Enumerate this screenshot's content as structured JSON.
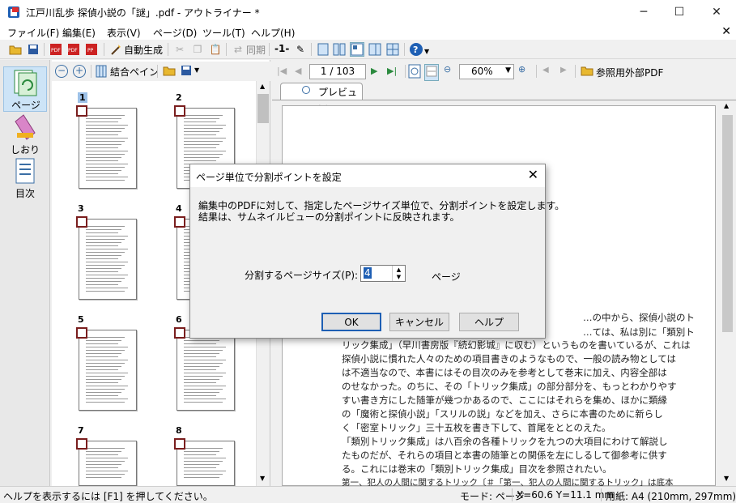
{
  "window": {
    "title": "江戸川乱歩 探偵小説の「謎」.pdf - アウトライナー *"
  },
  "menu": [
    "ファイル(F)",
    "編集(E)",
    "表示(V)",
    "ページ(D)",
    "ツール(T)",
    "ヘルプ(H)"
  ],
  "toolbar": {
    "auto_generate": "自動生成",
    "sync": "同期",
    "page_marker": "-1-",
    "help": "?"
  },
  "nav": {
    "pages": "ページ",
    "bookmarks": "しおり",
    "toc": "目次"
  },
  "thumb_toolbar": {
    "join_panes": "結合ペイン"
  },
  "thumbnails": [
    "1",
    "2",
    "3",
    "4",
    "5",
    "6",
    "7",
    "8"
  ],
  "viewer": {
    "page_field": "1 / 103",
    "zoom": "60%",
    "external_pdf": "参照用外部PDF",
    "tab": "プレビュー"
  },
  "pdf_lines": [
    "…の中から、探偵小説のト",
    "…ては、私は別に「類別ト",
    "リック集成」（早川書房版『続幻影城』に収む）というものを書いているが、これは",
    "探偵小説に慣れた人々のための項目書きのようなもので、一般の読み物としては",
    "は不適当なので、本書にはその目次のみを参考として巻末に加え、内容全部は",
    "のせなかった。のちに、その「トリック集成」の部分部分を、もっとわかりやす",
    "すい書き方にした随筆が幾つかあるので、ここにはそれらを集め、ほかに類縁",
    "の「魔術と探偵小説」「スリルの説」などを加え、さらに本書のために新らし",
    "く「密室トリック」三十五枚を書き下して、首尾をととのえた。",
    "「類別トリック集成」は八百余の各種トリックを九つの大項目にわけて解説し",
    "たものだが、それらの項目と本書の随筆との関係を左にしるして御参考に供す",
    "る。これには巻末の「類別トリック集成」目次を参照されたい。",
    "第一、犯人の人間に関するトリック〔＃「第一、犯人の人間に関するトリック」は底本"
  ],
  "dialog": {
    "title": "ページ単位で分割ポイントを設定",
    "line1": "編集中のPDFに対して、指定したページサイズ単位で、分割ポイントを設定します。",
    "line2": "結果は、サムネイルビューの分割ポイントに反映されます。",
    "field_label": "分割するページサイズ(P):",
    "field_value": "4",
    "unit": "ページ",
    "ok": "OK",
    "cancel": "キャンセル",
    "help": "ヘルプ"
  },
  "status": {
    "help": "ヘルプを表示するには [F1] を押してください。",
    "mode": "モード: ページ",
    "coords": "X=60.6 Y=11.1 mm",
    "paper": "用紙: A4 (210mm, 297mm)"
  },
  "colors": {
    "accent": "#1e5fb4",
    "marker": "#7a1e1e",
    "nav_active": "#cde4f7"
  }
}
